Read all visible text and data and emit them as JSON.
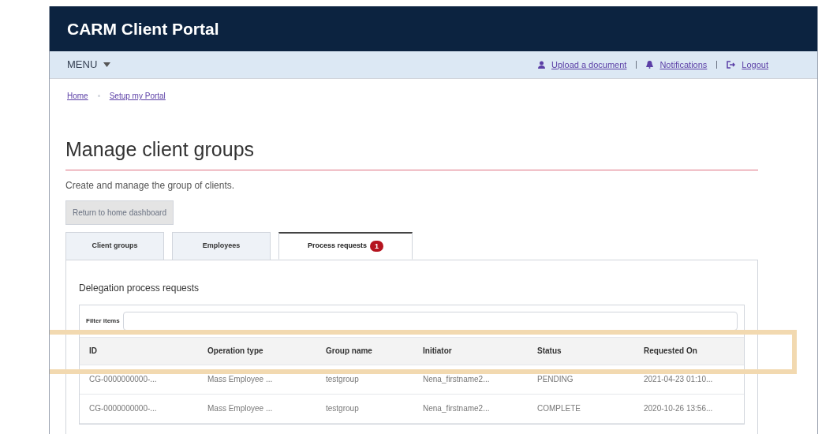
{
  "header": {
    "title": "CARM Client Portal"
  },
  "nav": {
    "menu": "MENU",
    "links": [
      {
        "kind": "upload",
        "label": "Upload a document"
      },
      {
        "kind": "bell",
        "label": "Notifications"
      },
      {
        "kind": "logout",
        "label": "Logout"
      }
    ]
  },
  "breadcrumbs": [
    "Home",
    "Setup my Portal"
  ],
  "page": {
    "title": "Manage client groups",
    "subtitle": "Create and manage the group of clients.",
    "button": "Return to home dashboard"
  },
  "tabs": [
    {
      "label": "Client groups",
      "selected": false
    },
    {
      "label": "Employees",
      "selected": false
    },
    {
      "label": "Process requests",
      "selected": true,
      "badge": "1"
    }
  ],
  "panel": {
    "title": "Delegation process requests",
    "filter_label": "Filter items"
  },
  "table": {
    "columns": [
      "ID",
      "Operation type",
      "Group name",
      "Initiator",
      "Status",
      "Requested On"
    ],
    "highlighted_header": true,
    "rows": [
      [
        "CG-0000000000-...",
        "Mass Employee ...",
        "testgroup",
        "Nena_firstname2...",
        "PENDING",
        "2021-04-23 01:10..."
      ],
      [
        "CG-0000000000-...",
        "Mass Employee ...",
        "testgroup",
        "Nena_firstname2...",
        "COMPLETE",
        "2020-10-26 13:56..."
      ]
    ]
  }
}
